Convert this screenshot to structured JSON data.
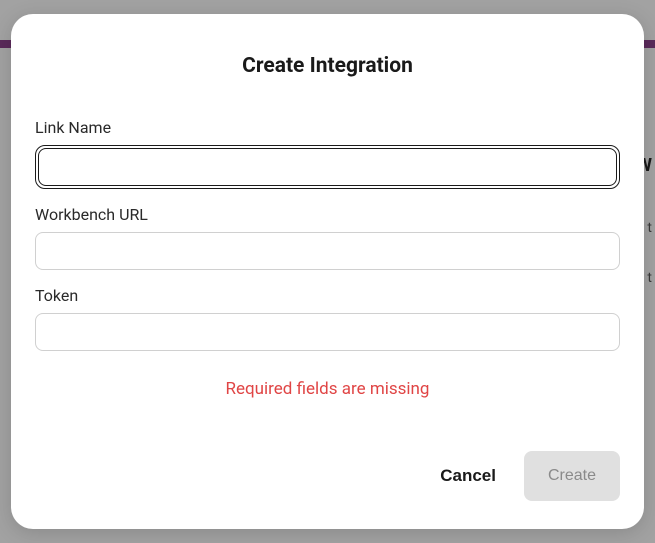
{
  "modal": {
    "title": "Create Integration",
    "fields": {
      "linkName": {
        "label": "Link Name",
        "value": "",
        "placeholder": ""
      },
      "workbenchUrl": {
        "label": "Workbench URL",
        "value": "",
        "placeholder": ""
      },
      "token": {
        "label": "Token",
        "value": "",
        "placeholder": ""
      }
    },
    "error": "Required fields are missing",
    "actions": {
      "cancel": "Cancel",
      "create": "Create"
    }
  },
  "backdrop": {
    "heading": "W",
    "line1": "t",
    "line2": "t"
  }
}
